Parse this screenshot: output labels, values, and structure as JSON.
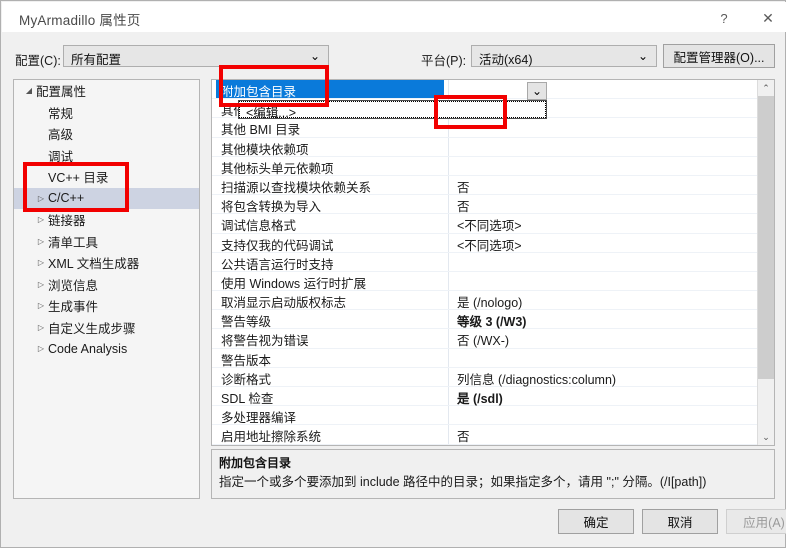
{
  "window": {
    "title": "MyArmadillo 属性页",
    "help_icon": "?",
    "close_icon": "✕"
  },
  "toolbar": {
    "config_label": "配置(C):",
    "config_value": "所有配置",
    "platform_label": "平台(P):",
    "platform_value": "活动(x64)",
    "config_manager_button": "配置管理器(O)...",
    "chevron": "⌄"
  },
  "tree": {
    "items": [
      {
        "label": "配置属性",
        "indent": 0,
        "twisty": "expanded",
        "selected": false
      },
      {
        "label": "常规",
        "indent": 1,
        "twisty": "none",
        "selected": false
      },
      {
        "label": "高级",
        "indent": 1,
        "twisty": "none",
        "selected": false
      },
      {
        "label": "调试",
        "indent": 1,
        "twisty": "none",
        "selected": false
      },
      {
        "label": "VC++ 目录",
        "indent": 1,
        "twisty": "none",
        "selected": false
      },
      {
        "label": "C/C++",
        "indent": 1,
        "twisty": "collapsed",
        "selected": true
      },
      {
        "label": "链接器",
        "indent": 1,
        "twisty": "collapsed",
        "selected": false
      },
      {
        "label": "清单工具",
        "indent": 1,
        "twisty": "collapsed",
        "selected": false
      },
      {
        "label": "XML 文档生成器",
        "indent": 1,
        "twisty": "collapsed",
        "selected": false
      },
      {
        "label": "浏览信息",
        "indent": 1,
        "twisty": "collapsed",
        "selected": false
      },
      {
        "label": "生成事件",
        "indent": 1,
        "twisty": "collapsed",
        "selected": false
      },
      {
        "label": "自定义生成步骤",
        "indent": 1,
        "twisty": "collapsed",
        "selected": false
      },
      {
        "label": "Code Analysis",
        "indent": 1,
        "twisty": "collapsed",
        "selected": false
      }
    ],
    "twisty_expanded_glyph": "◢",
    "twisty_collapsed_glyph": "▷"
  },
  "grid": {
    "rows": [
      {
        "name": "附加包含目录",
        "value": "",
        "selected": true,
        "bold": false
      },
      {
        "name": "其他 #using 指令",
        "value": "<编辑...>",
        "selected": false,
        "bold": false
      },
      {
        "name": "其他 BMI 目录",
        "value": "",
        "selected": false,
        "bold": false
      },
      {
        "name": "其他模块依赖项",
        "value": "",
        "selected": false,
        "bold": false
      },
      {
        "name": "其他标头单元依赖项",
        "value": "",
        "selected": false,
        "bold": false
      },
      {
        "name": "扫描源以查找模块依赖关系",
        "value": "否",
        "selected": false,
        "bold": false
      },
      {
        "name": "将包含转换为导入",
        "value": "否",
        "selected": false,
        "bold": false
      },
      {
        "name": "调试信息格式",
        "value": "<不同选项>",
        "selected": false,
        "bold": false
      },
      {
        "name": "支持仅我的代码调试",
        "value": "<不同选项>",
        "selected": false,
        "bold": false
      },
      {
        "name": "公共语言运行时支持",
        "value": "",
        "selected": false,
        "bold": false
      },
      {
        "name": "使用 Windows 运行时扩展",
        "value": "",
        "selected": false,
        "bold": false
      },
      {
        "name": "取消显示启动版权标志",
        "value": "是 (/nologo)",
        "selected": false,
        "bold": false
      },
      {
        "name": "警告等级",
        "value": "等级 3 (/W3)",
        "selected": false,
        "bold": true
      },
      {
        "name": "将警告视为错误",
        "value": "否 (/WX-)",
        "selected": false,
        "bold": false
      },
      {
        "name": "警告版本",
        "value": "",
        "selected": false,
        "bold": false
      },
      {
        "name": "诊断格式",
        "value": "列信息 (/diagnostics:column)",
        "selected": false,
        "bold": false
      },
      {
        "name": "SDL 检查",
        "value": "是 (/sdl)",
        "selected": false,
        "bold": true
      },
      {
        "name": "多处理器编译",
        "value": "",
        "selected": false,
        "bold": false
      },
      {
        "name": "启用地址擦除系统",
        "value": "否",
        "selected": false,
        "bold": false
      }
    ],
    "editor_value": "<编辑...>",
    "row_dropdown_chevron": "⌄",
    "scroll_up_glyph": "⌃",
    "scroll_down_glyph": "⌄"
  },
  "description": {
    "title": "附加包含目录",
    "body": "指定一个或多个要添加到 include 路径中的目录；如果指定多个，请用 \";\" 分隔。(/I[path])"
  },
  "buttons": {
    "ok": "确定",
    "cancel": "取消",
    "apply": "应用(A)"
  },
  "annotations": {
    "color": "#f20000",
    "boxes": [
      {
        "target": "附加包含目录"
      },
      {
        "target": "<编辑...>"
      },
      {
        "target": "C/C++"
      }
    ]
  }
}
